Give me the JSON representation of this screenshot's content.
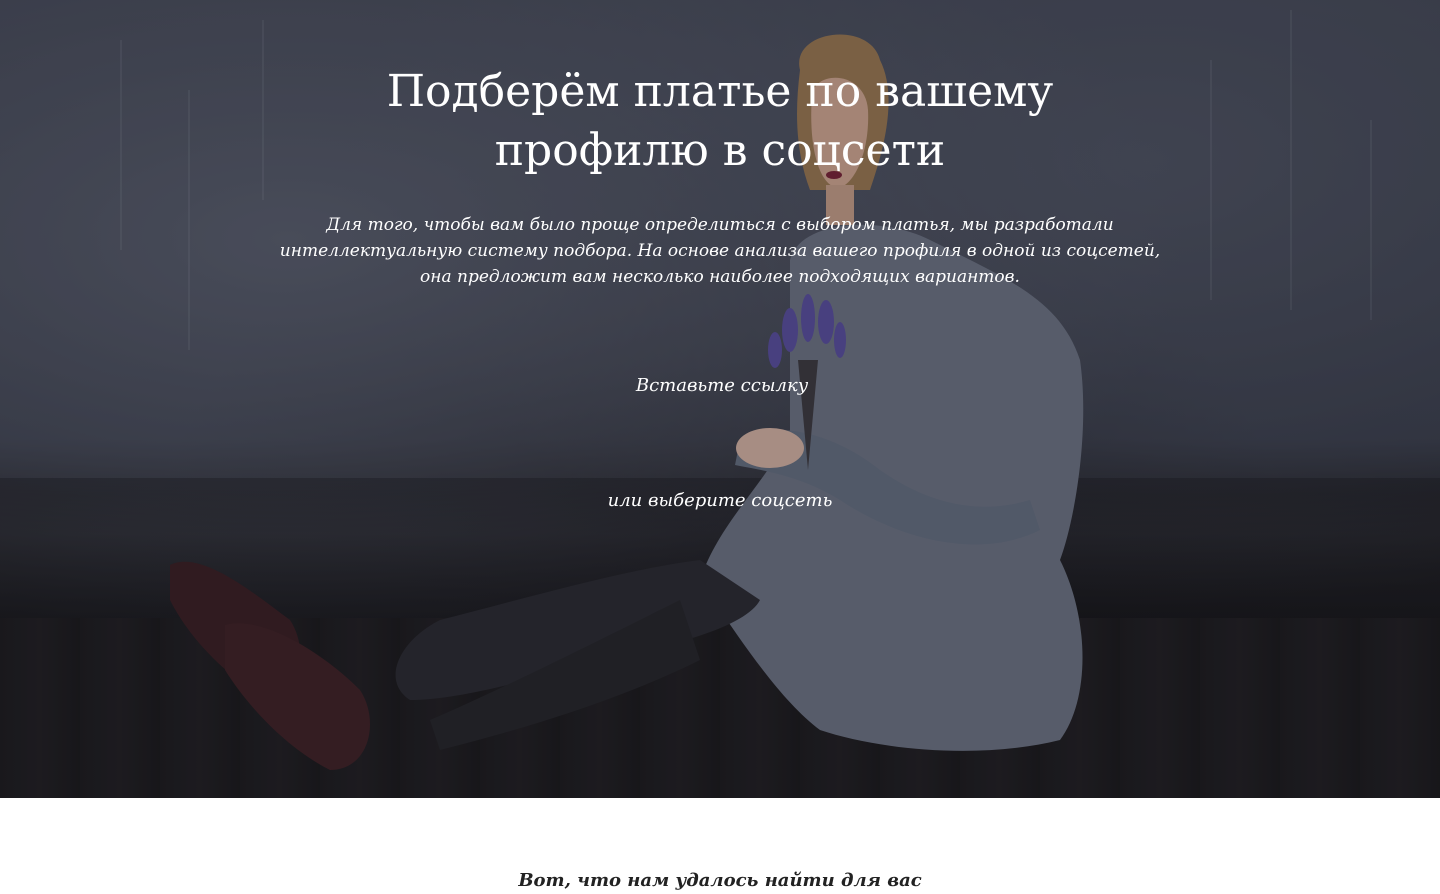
{
  "hero": {
    "title_lines": [
      "Подберём платье по вашему",
      "профилю в соцсети"
    ],
    "description_lines": [
      "Для того, чтобы вам было проще определиться с выбором платья, мы разработали",
      "интеллектуальную систему подбора. На основе анализа вашего профиля в одной из соцсетей,",
      "она предложит вам несколько наиболее подходящих вариантов."
    ],
    "link_input": {
      "placeholder": "Вставьте ссылку",
      "value": ""
    },
    "choose_social_label": "или выберите соцсеть"
  },
  "results": {
    "title": "Вот, что нам удалось найти для вас"
  },
  "colors": {
    "hero_text": "#ffffff",
    "page_background": "#ffffff",
    "results_text": "#222222"
  }
}
